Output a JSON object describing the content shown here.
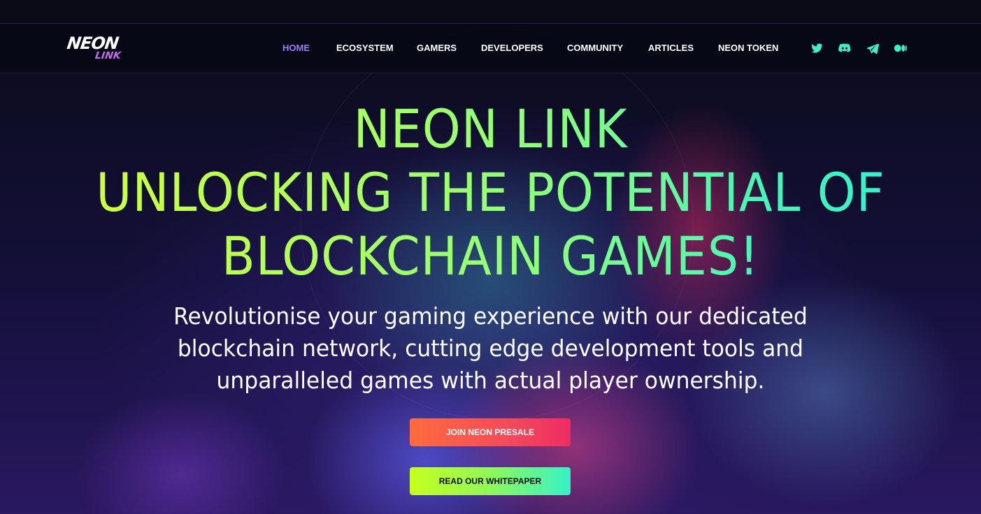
{
  "brand": {
    "logo_top": "NEON",
    "logo_bottom": "LINK"
  },
  "nav": {
    "items": [
      {
        "label": "HOME",
        "active": true
      },
      {
        "label": "ECOSYSTEM",
        "active": false
      },
      {
        "label": "GAMERS",
        "active": false
      },
      {
        "label": "DEVELOPERS",
        "active": false
      },
      {
        "label": "COMMUNITY",
        "active": false
      },
      {
        "label": "ARTICLES",
        "active": false
      },
      {
        "label": "NEON TOKEN",
        "active": false
      }
    ],
    "social_icons": [
      "twitter-icon",
      "discord-icon",
      "telegram-icon",
      "medium-icon"
    ]
  },
  "hero": {
    "title_lines": [
      "NEON LINK",
      "UNLOCKING THE POTENTIAL OF",
      "BLOCKCHAIN GAMES!"
    ],
    "subtitle_lines": [
      "Revolutionise your gaming experience with our dedicated",
      "blockchain network, cutting edge development tools and",
      "unparalleled games with actual player ownership."
    ]
  },
  "buttons": {
    "presale": "JOIN NEON PRESALE",
    "whitepaper": "READ OUR WHITEPAPER"
  },
  "colors": {
    "active_nav": "#9b7bff",
    "social_icon": "#3ef0c8",
    "title_gradient_start": "#d4ff3c",
    "title_gradient_end": "#2ff0d2",
    "presale_gradient_start": "#ff6b3d",
    "presale_gradient_end": "#ee2d63",
    "whitepaper_gradient_start": "#c6ff1e",
    "whitepaper_gradient_end": "#36f2c6",
    "logo_accent": "#c26cf0"
  }
}
